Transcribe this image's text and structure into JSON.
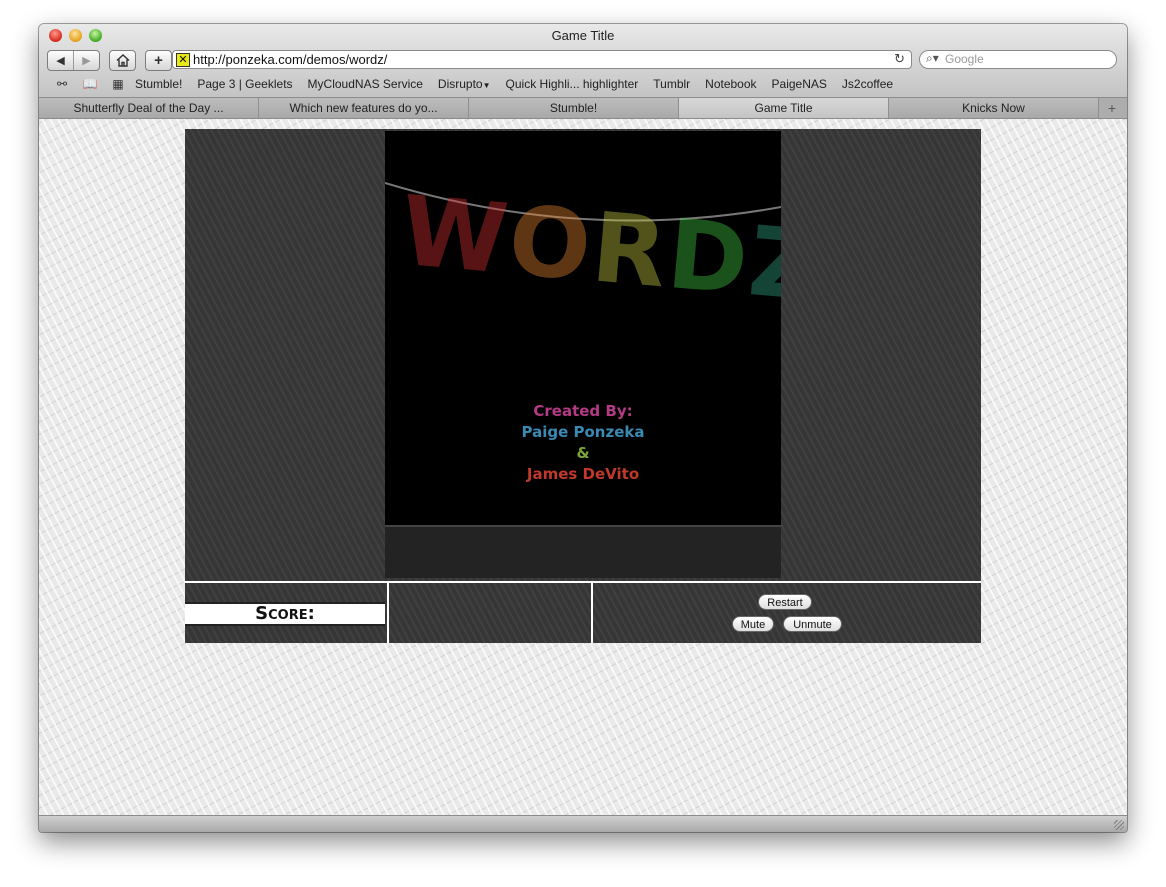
{
  "window": {
    "title": "Game Title"
  },
  "toolbar": {
    "url": "http://ponzeka.com/demos/wordz/",
    "search_placeholder": "Google",
    "back_icon": "back-arrow-icon",
    "forward_icon": "forward-arrow-icon",
    "home_icon": "home-icon",
    "add_icon": "plus-icon",
    "reload_icon": "reload-icon"
  },
  "bookmarks": [
    "Stumble!",
    "Page 3 | Geeklets",
    "MyCloudNAS Service",
    "Disrupto",
    "Quick Highli... highlighter",
    "Tumblr",
    "Notebook",
    "PaigeNAS",
    "Js2coffee"
  ],
  "tabs": [
    {
      "label": "Shutterfly Deal of the Day ...",
      "active": false
    },
    {
      "label": "Which new features do yo...",
      "active": false
    },
    {
      "label": "Stumble!",
      "active": false
    },
    {
      "label": "Game Title",
      "active": true
    },
    {
      "label": "Knicks Now",
      "active": false
    }
  ],
  "game": {
    "logo": "WORDZ!",
    "credits": [
      "Created By:",
      "Paige Ponzeka",
      "&",
      "James DeVito"
    ],
    "credit_colors": [
      "#b43a86",
      "#3a8ab4",
      "#7aa83a",
      "#c0392b"
    ],
    "logo_colors": [
      "#d33",
      "#e83",
      "#cc4",
      "#4c4",
      "#3a8",
      "#38c"
    ]
  },
  "panel": {
    "score_label": "Score:",
    "restart_label": "Restart",
    "mute_label": "Mute",
    "unmute_label": "Unmute"
  }
}
